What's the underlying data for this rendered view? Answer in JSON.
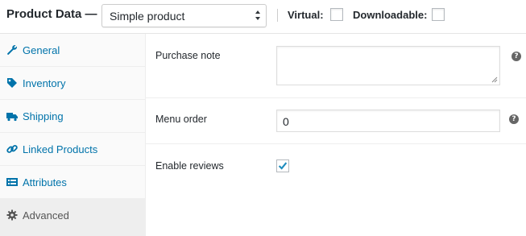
{
  "header": {
    "title": "Product Data —",
    "product_type": {
      "selected": "Simple product"
    },
    "virtual_label": "Virtual:",
    "virtual_checked": false,
    "downloadable_label": "Downloadable:",
    "downloadable_checked": false
  },
  "tabs": [
    {
      "label": "General",
      "icon": "wrench-icon",
      "active": false
    },
    {
      "label": "Inventory",
      "icon": "tag-icon",
      "active": false
    },
    {
      "label": "Shipping",
      "icon": "truck-icon",
      "active": false
    },
    {
      "label": "Linked Products",
      "icon": "link-icon",
      "active": false
    },
    {
      "label": "Attributes",
      "icon": "list-icon",
      "active": false
    },
    {
      "label": "Advanced",
      "icon": "gear-icon",
      "active": true
    }
  ],
  "fields": {
    "purchase_note": {
      "label": "Purchase note",
      "value": ""
    },
    "menu_order": {
      "label": "Menu order",
      "value": "0"
    },
    "enable_reviews": {
      "label": "Enable reviews",
      "checked": true
    }
  },
  "help_glyph": "?",
  "colors": {
    "link": "#0073aa",
    "check": "#1e8cbe",
    "help": "#666666"
  }
}
